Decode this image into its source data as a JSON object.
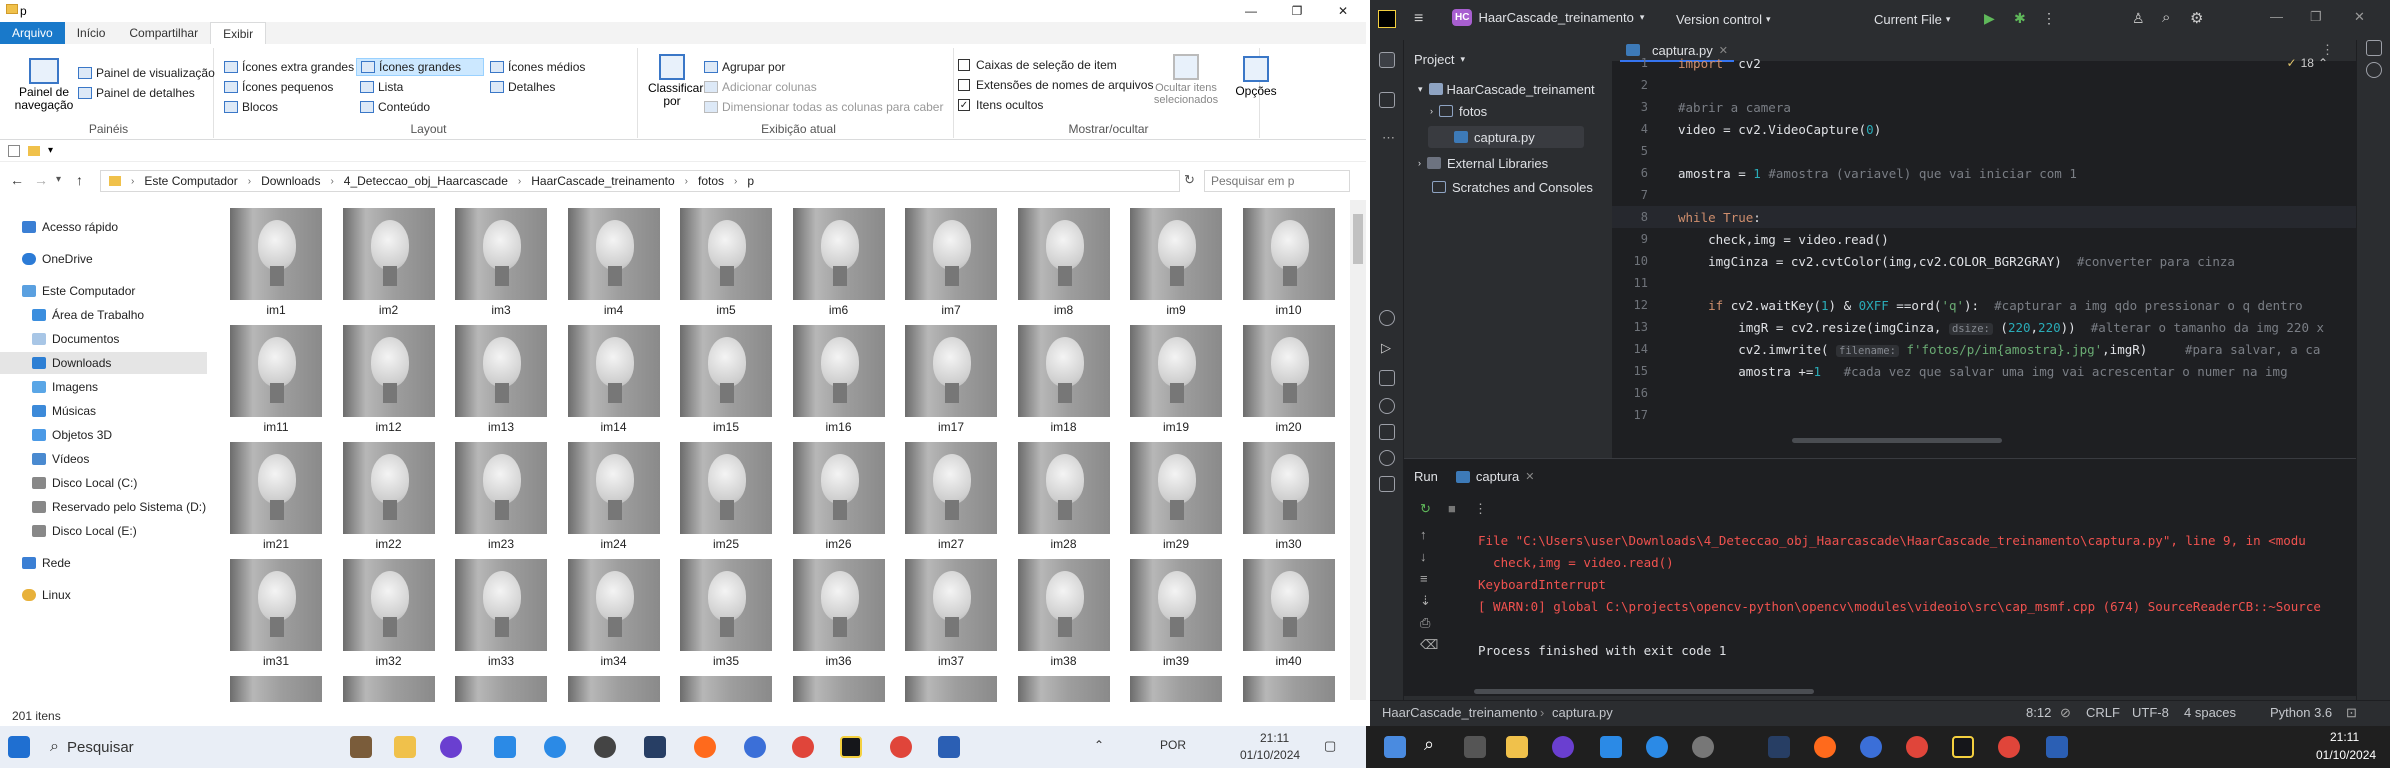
{
  "explorer": {
    "window_title": "p",
    "ribbon_tabs": [
      "Arquivo",
      "Início",
      "Compartilhar",
      "Exibir"
    ],
    "panes": {
      "nav_pane": "Painel de navegação",
      "preview": "Painel de visualização",
      "details": "Painel de detalhes",
      "label": "Painéis"
    },
    "layout": {
      "items": [
        "Ícones extra grandes",
        "Ícones grandes",
        "Ícones médios",
        "Ícones pequenos",
        "Lista",
        "Detalhes",
        "Blocos",
        "Conteúdo"
      ],
      "label": "Layout"
    },
    "current_view": {
      "sort": "Classificar por",
      "group": "Agrupar por",
      "add_columns": "Adicionar colunas",
      "size_all": "Dimensionar todas as colunas para caber",
      "label": "Exibição atual"
    },
    "show_hide": {
      "item_checkboxes": "Caixas de seleção de item",
      "extensions": "Extensões de nomes de arquivos",
      "hidden": "Itens ocultos",
      "hide_selected": "Ocultar itens selecionados",
      "label": "Mostrar/ocultar"
    },
    "options": "Opções",
    "breadcrumb": [
      "Este Computador",
      "Downloads",
      "4_Deteccao_obj_Haarcascade",
      "HaarCascade_treinamento",
      "fotos",
      "p"
    ],
    "search_placeholder": "Pesquisar em p",
    "nav": [
      "Acesso rápido",
      "OneDrive",
      "Este Computador",
      "Área de Trabalho",
      "Documentos",
      "Downloads",
      "Imagens",
      "Músicas",
      "Objetos 3D",
      "Vídeos",
      "Disco Local (C:)",
      "Reservado pelo Sistema (D:)",
      "Disco Local (E:)",
      "Rede",
      "Linux"
    ],
    "thumbs": [
      "im1",
      "im2",
      "im3",
      "im4",
      "im5",
      "im6",
      "im7",
      "im8",
      "im9",
      "im10",
      "im11",
      "im12",
      "im13",
      "im14",
      "im15",
      "im16",
      "im17",
      "im18",
      "im19",
      "im20",
      "im21",
      "im22",
      "im23",
      "im24",
      "im25",
      "im26",
      "im27",
      "im28",
      "im29",
      "im30",
      "im31",
      "im32",
      "im33",
      "im34",
      "im35",
      "im36",
      "im37",
      "im38",
      "im39",
      "im40"
    ],
    "status": "201 itens"
  },
  "ide": {
    "project_badge": "HC",
    "project_name": "HaarCascade_treinamento",
    "vcs": "Version control",
    "run_config": "Current File",
    "project_label": "Project",
    "tree": [
      "HaarCascade_treinament",
      "fotos",
      "captura.py",
      "External Libraries",
      "Scratches and Consoles"
    ],
    "tab": "captura.py",
    "warnings": "18",
    "code": [
      {
        "n": "1",
        "t": "import  cv2"
      },
      {
        "n": "2",
        "t": ""
      },
      {
        "n": "3",
        "t": "#abrir a camera"
      },
      {
        "n": "4",
        "t": "video = cv2.VideoCapture(0)"
      },
      {
        "n": "5",
        "t": ""
      },
      {
        "n": "6",
        "t": "amostra = 1 #amostra (variavel) que vai iniciar com 1"
      },
      {
        "n": "7",
        "t": ""
      },
      {
        "n": "8",
        "t": "while True:"
      },
      {
        "n": "9",
        "t": "    check,img = video.read()"
      },
      {
        "n": "10",
        "t": "    imgCinza = cv2.cvtColor(img,cv2.COLOR_BGR2GRAY)  #converter para cinza"
      },
      {
        "n": "11",
        "t": ""
      },
      {
        "n": "12",
        "t": "    if cv2.waitKey(1) & 0XFF ==ord('q'):  #capturar a img qdo pressionar o q dentro"
      },
      {
        "n": "13",
        "t": "        imgR = cv2.resize(imgCinza, dsize: (220,220))  #alterar o tamanho da img 220 x"
      },
      {
        "n": "14",
        "t": "        cv2.imwrite( filename: f'fotos/p/im{amostra}.jpg',imgR)     #para salvar, a ca"
      },
      {
        "n": "15",
        "t": "        amostra +=1   #cada vez que salvar uma img vai acrescentar o numer na img"
      },
      {
        "n": "16",
        "t": ""
      },
      {
        "n": "17",
        "t": ""
      }
    ],
    "run_label": "Run",
    "run_tab": "captura",
    "output": [
      "File \"C:\\Users\\user\\Downloads\\4_Deteccao_obj_Haarcascade\\HaarCascade_treinamento\\captura.py\", line 9, in <modu",
      "  check,img = video.read()",
      "KeyboardInterrupt",
      "[ WARN:0] global C:\\projects\\opencv-python\\opencv\\modules\\videoio\\src\\cap_msmf.cpp (674) SourceReaderCB::~Source",
      "",
      "Process finished with exit code 1"
    ],
    "status_path": [
      "HaarCascade_treinamento",
      "captura.py"
    ],
    "status_right": [
      "8:12",
      "CRLF",
      "UTF-8",
      "4 spaces",
      "Python 3.6"
    ]
  },
  "taskbar": {
    "search": "Pesquisar",
    "lang": "POR",
    "time": "21:11",
    "date": "01/10/2024"
  }
}
